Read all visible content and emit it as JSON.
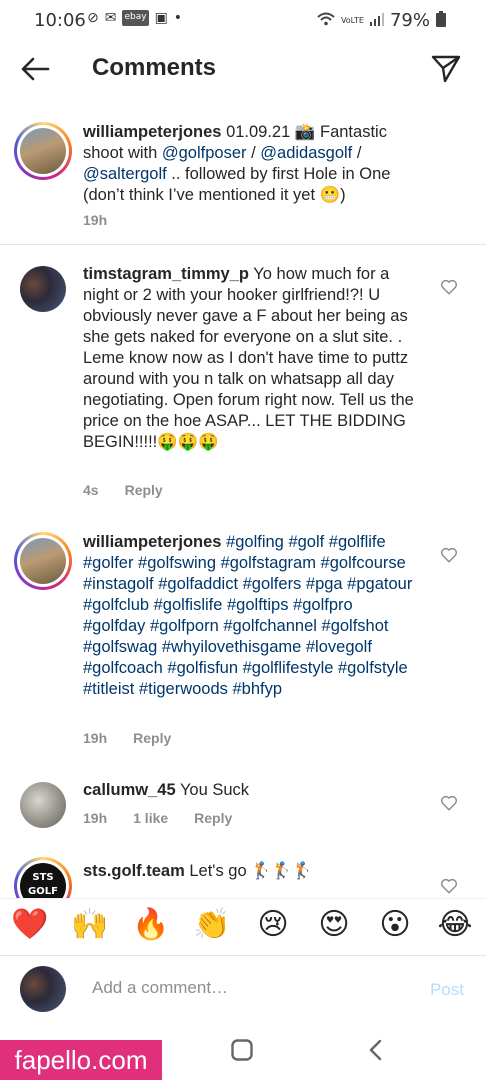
{
  "status_bar": {
    "time": "10:06",
    "battery": "79%"
  },
  "header": {
    "title": "Comments"
  },
  "comments": [
    {
      "username": "williampeterjones",
      "text_parts": [
        "01.09.21 📸 Fantastic shoot with ",
        "@golfposer",
        " / ",
        "@adidasgolf",
        " / ",
        "@saltergolf",
        " .. followed by first Hole in One (don’t think I’ve mentioned it yet 😬)"
      ],
      "time": "19h"
    },
    {
      "username": "timstagram_timmy_p",
      "text": "Yo how much for a night or 2 with your hooker girlfriend!?! U obviously never gave a F about her being as she gets naked for everyone on a slut site. . Leme know now as I don't have time to puttz around with you n talk on whatsapp all day negotiating. Open forum right now. Tell us the price on the hoe ASAP... LET THE BIDDING BEGIN!!!!!🤑🤑🤑",
      "time": "4s",
      "reply": "Reply"
    },
    {
      "username": "williampeterjones",
      "hashtags": "#golfing #golf #golflife #golfer #golfswing #golfstagram #golfcourse #instagolf #golfaddict #golfers #pga #pgatour #golfclub #golfislife #golftips #golfpro #golfday #golfporn #golfchannel #golfshot #golfswag #whyilovethisgame #lovegolf #golfcoach #golfisfun #golflifestyle #golfstyle #titleist #tigerwoods #bhfyp",
      "time": "19h",
      "reply": "Reply"
    },
    {
      "username": "callumw_45",
      "text": "You Suck",
      "time": "19h",
      "likes": "1 like",
      "reply": "Reply"
    },
    {
      "username": "sts.golf.team",
      "text": "Let's go 🏌️🏌️🏌️",
      "avatar_text": "STS GOLF"
    }
  ],
  "emoji_bar": [
    "❤️",
    "🙌",
    "🔥",
    "👏",
    "😢",
    "😍",
    "😮",
    "😂"
  ],
  "add_comment": {
    "placeholder": "Add a comment…",
    "post_label": "Post"
  },
  "watermark": "fapello.com"
}
